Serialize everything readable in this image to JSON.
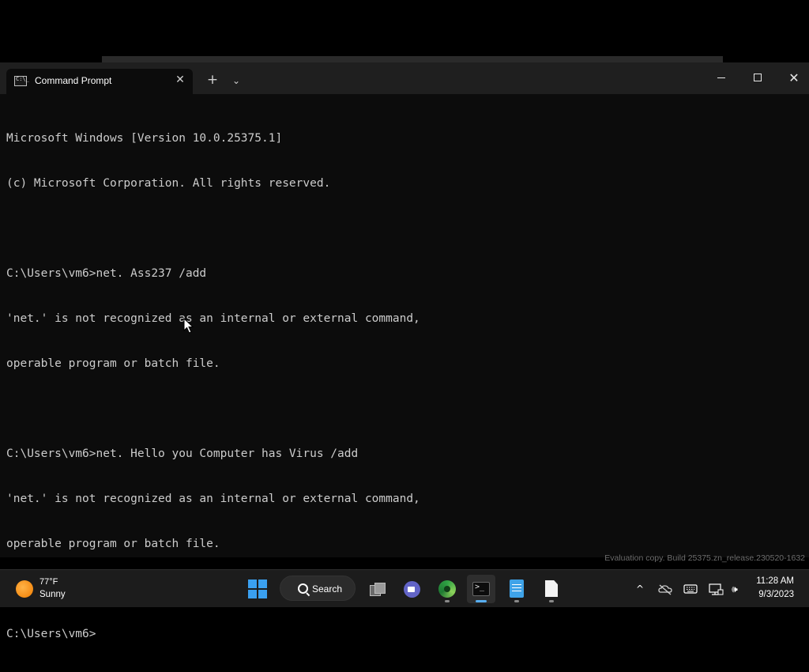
{
  "window": {
    "tab_title": "Command Prompt",
    "close_glyph": "✕",
    "new_tab_glyph": "+",
    "dropdown_glyph": "⌄",
    "close_window_glyph": "✕"
  },
  "console": {
    "lines": [
      "Microsoft Windows [Version 10.0.25375.1]",
      "(c) Microsoft Corporation. All rights reserved.",
      "",
      "C:\\Users\\vm6>net. Ass237 /add",
      "'net.' is not recognized as an internal or external command,",
      "operable program or batch file.",
      "",
      "C:\\Users\\vm6>net. Hello you Computer has Virus /add",
      "'net.' is not recognized as an internal or external command,",
      "operable program or batch file.",
      "",
      "C:\\Users\\vm6>"
    ]
  },
  "watermark": "Evaluation copy. Build 25375.zn_release.230520-1632",
  "taskbar": {
    "weather": {
      "temp": "77°F",
      "desc": "Sunny"
    },
    "search_label": "Search",
    "tray": {
      "chevron": "^",
      "volume_glyph": "🕪"
    },
    "clock": {
      "time": "11:28 AM",
      "date": "9/3/2023"
    }
  },
  "colors": {
    "console_bg": "#0c0c0c",
    "console_text": "#cccccc",
    "titlebar": "#1f1f1f",
    "taskbar": "#1c1c1c",
    "accent": "#58aef0"
  }
}
